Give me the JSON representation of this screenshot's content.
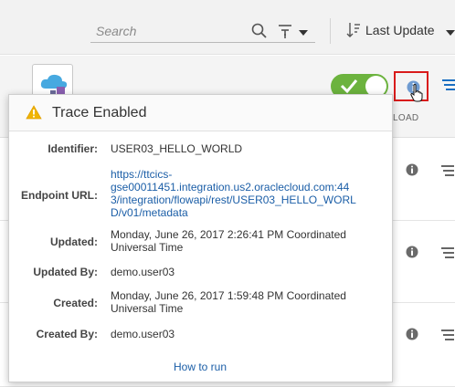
{
  "toolbar": {
    "search_placeholder": "Search",
    "sort_label": "Last Update"
  },
  "row2": {
    "load_label": "LOAD",
    "trace_toggle_on": true
  },
  "popup": {
    "title": "Trace Enabled",
    "fields": [
      {
        "label": "Identifier:",
        "value": "USER03_HELLO_WORLD"
      },
      {
        "label": "Endpoint URL:",
        "value_lines": [
          "https://ttcics-",
          "gse00011451.integration.us2.oraclecloud.com:44",
          "3/integration/flowapi/rest/USER03_HELLO_WORL",
          "D/v01/metadata"
        ]
      },
      {
        "label": "Updated:",
        "value_lines": [
          "Monday, June 26, 2017 2:26:41 PM Coordinated",
          "Universal Time"
        ]
      },
      {
        "label": "Updated By:",
        "value": "demo.user03"
      },
      {
        "label": "Created:",
        "value_lines": [
          "Monday, June 26, 2017 1:59:48 PM Coordinated",
          "Universal Time"
        ]
      },
      {
        "label": "Created By:",
        "value": "demo.user03"
      }
    ],
    "how_to_run": "How to run"
  },
  "colors": {
    "toggle_on": "#6cb33e",
    "highlight_border": "#d91b1b",
    "link": "#1b5ea7",
    "warning": "#f0b400",
    "info_icon": "#6a6a6a",
    "menu_icon": "#1b6fc2"
  },
  "icons": [
    "search-icon",
    "filter-icon",
    "chevron-down-icon",
    "sort-icon",
    "cloud-integration-icon",
    "check-icon",
    "info-icon",
    "menu-lines-icon",
    "warning-icon",
    "pointer-cursor-icon"
  ]
}
